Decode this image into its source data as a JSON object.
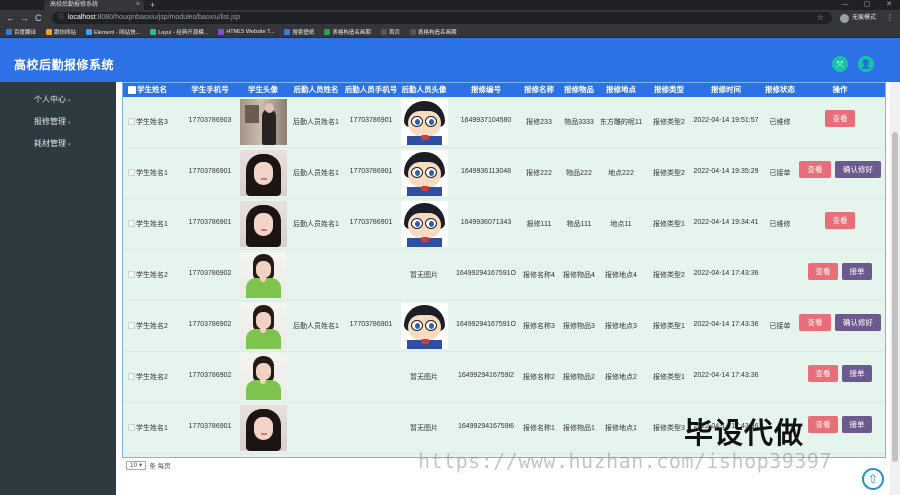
{
  "browser": {
    "tab_title": "高校后勤报修系统",
    "tab_close": "×",
    "new_tab": "+",
    "window_controls": [
      "—",
      "▢",
      "✕"
    ],
    "nav": {
      "back": "←",
      "forward": "→",
      "reload": "C"
    },
    "url_icon": "ⓘ",
    "url_host": "localhost",
    "url_path": ":8080/houqinbaoxiu/jsp/modules/baoxiu/list.jsp",
    "star": "☆",
    "profile_label": "无痕模式",
    "menu": "⋮",
    "bookmarks": [
      {
        "label": "百度翻译",
        "color": "#3b7ae0"
      },
      {
        "label": "跟你网站",
        "color": "#f0a020"
      },
      {
        "label": "Element - 网站快...",
        "color": "#409eff"
      },
      {
        "label": "Layui - 经典开源模...",
        "color": "#2fb99a"
      },
      {
        "label": "HTML5 Website T...",
        "color": "#7a4fd0"
      },
      {
        "label": "搜索壁纸",
        "color": "#3b7ae0"
      },
      {
        "label": "表格构造名画期",
        "color": "#2fa04a"
      },
      {
        "label": "首页",
        "color": "#555555"
      },
      {
        "label": "表格构造名画期",
        "color": "#555555"
      }
    ]
  },
  "app": {
    "title": "高校后勤报修系统",
    "header_buttons": {
      "fullscreen": "⤧",
      "user": "👤"
    }
  },
  "sidebar": {
    "items": [
      {
        "label": "个人中心",
        "caret": "▾"
      },
      {
        "label": "报修管理",
        "caret": "▾"
      },
      {
        "label": "耗材管理",
        "caret": "▾"
      }
    ]
  },
  "table": {
    "headers": [
      "学生姓名",
      "学生手机号",
      "学生头像",
      "后勤人员姓名",
      "后勤人员手机号",
      "后勤人员头像",
      "报修编号",
      "报修名称",
      "报修物品",
      "报修地点",
      "报修类型",
      "报修时间",
      "报修状态",
      "操作"
    ],
    "rows": [
      {
        "student_name": "学生姓名3",
        "student_phone": "17703786903",
        "student_avatar": "room",
        "staff_name": "后勤人员姓名1",
        "staff_phone": "17703786901",
        "staff_avatar": "conan",
        "no_image": "",
        "repair_no": "1649937104580",
        "repair_name": "报修233",
        "item": "物品3333",
        "location": "东方雕的呢11",
        "type": "报修类型2",
        "time": "2022-04-14 19:51:57",
        "status": "已维修",
        "buttons": [
          "查看"
        ]
      },
      {
        "student_name": "学生姓名1",
        "student_phone": "17703786901",
        "student_avatar": "girl",
        "staff_name": "后勤人员姓名1",
        "staff_phone": "17703786901",
        "staff_avatar": "conan",
        "no_image": "",
        "repair_no": "1649936113048",
        "repair_name": "报修222",
        "item": "物品222",
        "location": "地点222",
        "type": "报修类型2",
        "time": "2022-04-14 19:35:29",
        "status": "已接单",
        "buttons": [
          "查看",
          "确认修好"
        ]
      },
      {
        "student_name": "学生姓名1",
        "student_phone": "17703786901",
        "student_avatar": "girl",
        "staff_name": "后勤人员姓名1",
        "staff_phone": "17703786901",
        "staff_avatar": "conan",
        "no_image": "",
        "repair_no": "1649936071343",
        "repair_name": "报修111",
        "item": "物品111",
        "location": "地点11",
        "type": "报修类型1",
        "time": "2022-04-14 19:34:41",
        "status": "已维修",
        "buttons": [
          "查看"
        ]
      },
      {
        "student_name": "学生姓名2",
        "student_phone": "17703786902",
        "student_avatar": "green",
        "staff_name": "",
        "staff_phone": "",
        "staff_avatar": "",
        "no_image": "暂无图片",
        "repair_no": "16499294167591O",
        "repair_name": "报修名称4",
        "item": "报修物品4",
        "location": "报修地点4",
        "type": "报修类型2",
        "time": "2022-04-14 17:43:36",
        "status": "",
        "buttons": [
          "查看",
          "接单"
        ]
      },
      {
        "student_name": "学生姓名2",
        "student_phone": "17703786902",
        "student_avatar": "green",
        "staff_name": "后勤人员姓名1",
        "staff_phone": "17703786901",
        "staff_avatar": "conan",
        "no_image": "",
        "repair_no": "16499294167591O",
        "repair_name": "报修名称3",
        "item": "报修物品3",
        "location": "报修地点3",
        "type": "报修类型1",
        "time": "2022-04-14 17:43:36",
        "status": "已接单",
        "buttons": [
          "查看",
          "确认修好"
        ]
      },
      {
        "student_name": "学生姓名2",
        "student_phone": "17703786902",
        "student_avatar": "green",
        "staff_name": "",
        "staff_phone": "",
        "staff_avatar": "",
        "no_image": "暂无图片",
        "repair_no": "1649929416759l2",
        "repair_name": "报修名称2",
        "item": "报修物品2",
        "location": "报修地点2",
        "type": "报修类型1",
        "time": "2022-04-14 17:43:36",
        "status": "",
        "buttons": [
          "查看",
          "接单"
        ]
      },
      {
        "student_name": "学生姓名1",
        "student_phone": "17703786901",
        "student_avatar": "girl",
        "staff_name": "",
        "staff_phone": "",
        "staff_avatar": "",
        "no_image": "暂无图片",
        "repair_no": "1649929416759l6",
        "repair_name": "报修名称1",
        "item": "报修物品1",
        "location": "报修地点1",
        "type": "报修类型3",
        "time": "2022-04-14 17:43:36",
        "status": "",
        "buttons": [
          "查看",
          "接单"
        ]
      }
    ]
  },
  "pager": {
    "page_size": "10 ▾",
    "suffix": "条 每页"
  },
  "watermark": {
    "main": "毕设代做",
    "url": "https://www.huzhan.com/ishop39397"
  },
  "back_to_top": "⇧",
  "colors": {
    "header": "#2d71e6",
    "sidebar": "#2d3a40",
    "table_bg": "#e6f4ee",
    "view_button": "#e86e79",
    "action_button": "#6c5a8f",
    "header_icon_bg": "#17c2a6"
  }
}
